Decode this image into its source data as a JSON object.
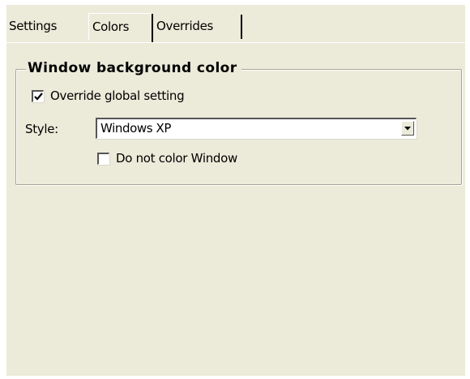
{
  "tabs": [
    {
      "label": "Settings",
      "active": false
    },
    {
      "label": "Colors",
      "active": true
    },
    {
      "label": "Overrides",
      "active": false
    }
  ],
  "group": {
    "title": "Window background color",
    "override_checkbox": {
      "label": "Override global setting",
      "checked": true
    },
    "style": {
      "label": "Style:",
      "value": "Windows XP"
    },
    "no_color_checkbox": {
      "label": "Do not color Window",
      "checked": false
    }
  },
  "colors": {
    "face": "#ecead9",
    "border": "#a8a596",
    "highlight": "#ffffff",
    "shadow": "#555555"
  },
  "icons": {
    "check": "check-icon",
    "dropdown": "dropdown-arrow-icon"
  }
}
